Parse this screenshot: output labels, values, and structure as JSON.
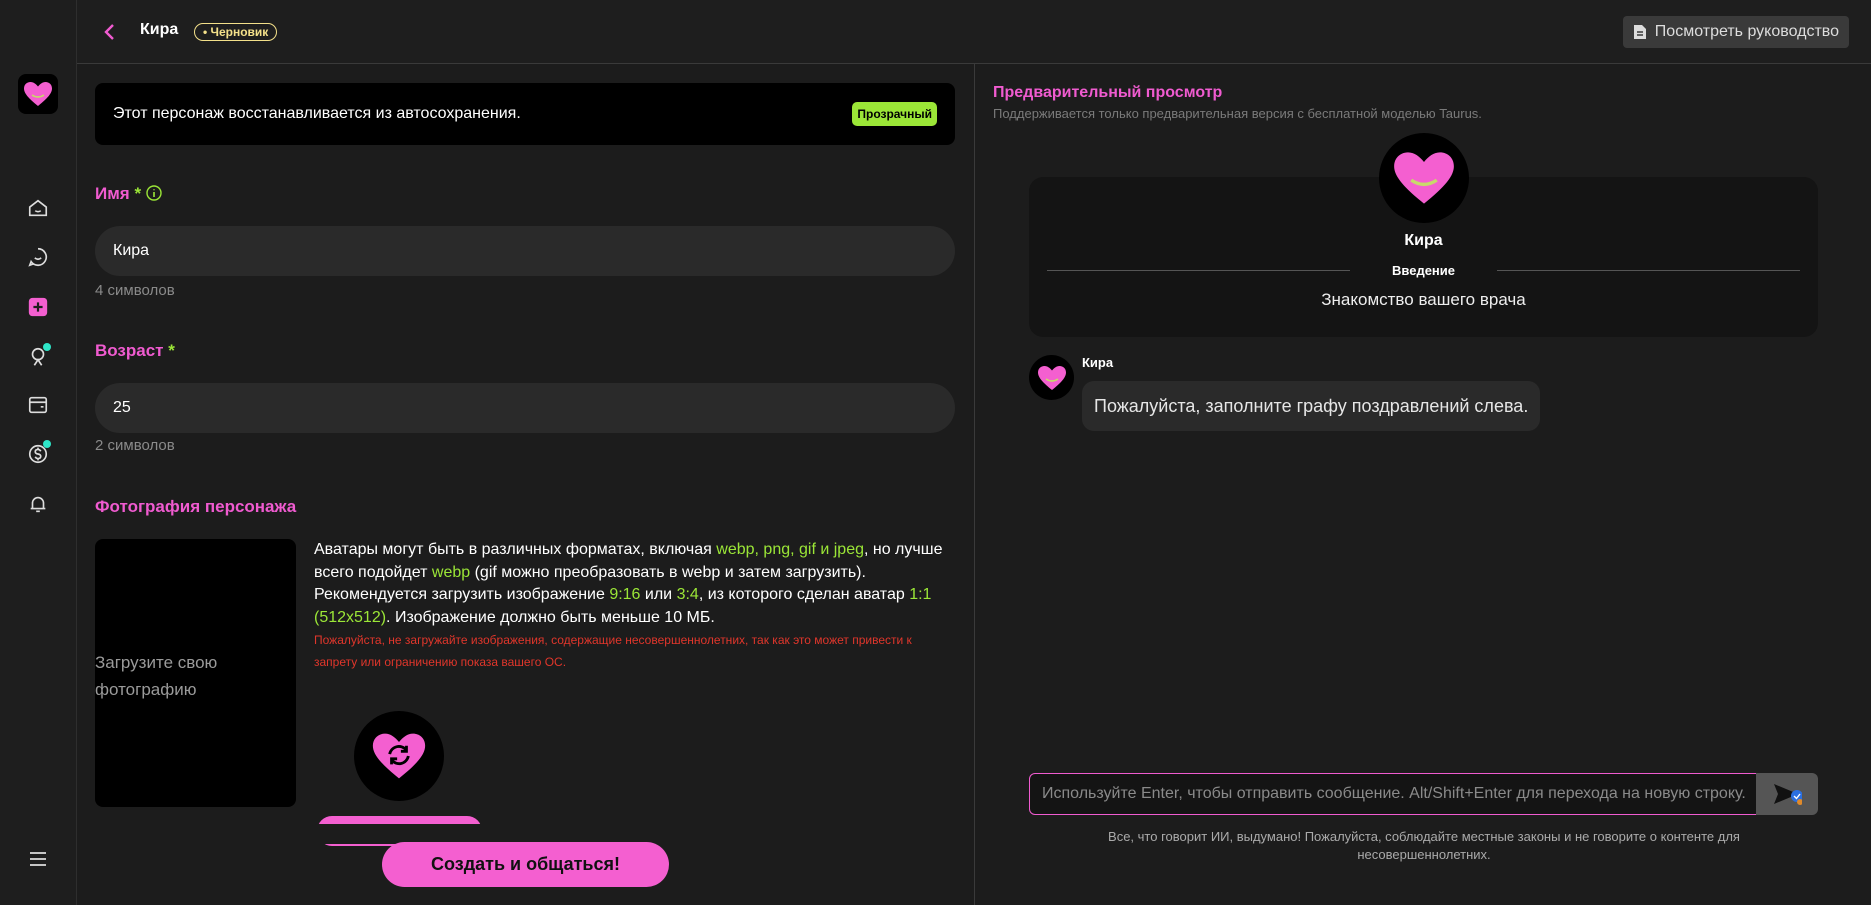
{
  "header": {
    "title": "Кира",
    "draft_badge": "• Черновик",
    "guide_label": "Посмотреть руководство"
  },
  "sidebar": {
    "items": [
      "home-icon",
      "chat-icon",
      "create-icon",
      "character-icon",
      "wallet-icon",
      "coin-icon",
      "bell-icon"
    ],
    "menu": "menu-icon"
  },
  "form": {
    "autosave_notice": "Этот персонаж восстанавливается из автосохранения.",
    "transparent_badge": "Прозрачный",
    "name_label": "Имя",
    "name_required": "*",
    "name_value": "Кира",
    "name_count": "4 символов",
    "age_label": "Возраст",
    "age_required": "*",
    "age_value": "25",
    "age_count": "2 символов",
    "photo_label": "Фотография персонажа",
    "upload_text": "Загрузите свою фотографию",
    "photo_desc": {
      "p1": "Аватары могут быть в различных форматах, включая ",
      "h1": "webp, png, gif и jpeg",
      "p2": ", но лучше всего подойдет ",
      "h2": "webp",
      "p3": " (gif можно преобразовать в webp и затем загрузить). Рекомендуется загрузить изображение ",
      "h3": "9:16",
      "p4": " или ",
      "h4": "3:4",
      "p5": ", из которого сделан аватар ",
      "h5": "1:1 (512x512)",
      "p6": ". Изображение должно быть меньше 10 МБ."
    },
    "warning": "Пожалуйста, не загружайте изображения, содержащие несовершеннолетних, так как это может привести к запрету или ограничению показа вашего ОС.",
    "create_button": "Создать и общаться!"
  },
  "preview": {
    "title": "Предварительный просмотр",
    "subtitle": "Поддерживается только предварительная версия с бесплатной моделью Taurus.",
    "char_name": "Кира",
    "intro_label": "Введение",
    "intro_text": "Знакомство вашего врача",
    "msg_name": "Кира",
    "msg_text": "Пожалуйста, заполните графу поздравлений слева.",
    "input_placeholder": "Используйте Enter, чтобы отправить сообщение. Alt/Shift+Enter для перехода на новую строку.",
    "disclaimer": "Все, что говорит ИИ, выдумано! Пожалуйста, соблюдайте местные законы и не говорите о контенте для несовершеннолетних."
  },
  "colors": {
    "accent_pink": "#f05bd0",
    "accent_green": "#9be637",
    "warning_red": "#e0362b",
    "draft_yellow": "#f3e08a"
  }
}
